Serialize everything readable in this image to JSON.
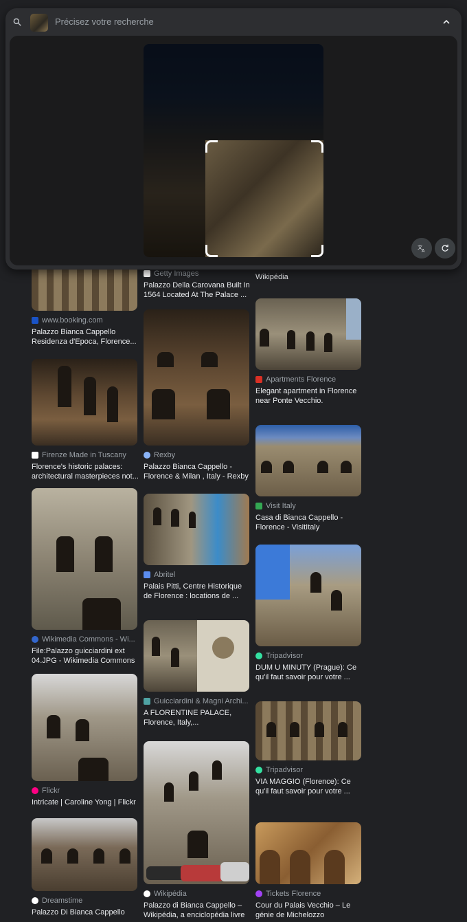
{
  "search": {
    "placeholder": "Précisez votre recherche",
    "icons": {
      "search": "search-icon",
      "collapse": "chevron-up-icon",
      "translate": "translate-icon",
      "rotate": "rotate-icon"
    }
  },
  "results": {
    "col1": [
      {
        "source": "www.booking.com",
        "source_color": "#1a53c6",
        "title": "Palazzo Bianca Cappello Residenza d'Epoca, Florence..."
      },
      {
        "source": "Firenze Made in Tuscany",
        "source_color": "#ffffff",
        "title": "Florence's historic palaces: architectural masterpieces not..."
      },
      {
        "source": "Wikimedia Commons - Wi...",
        "source_color": "#3366cc",
        "title": "File:Palazzo guicciardini ext 04.JPG - Wikimedia Commons"
      },
      {
        "source": "Flickr",
        "source_color": "#ff0084",
        "title": "Intricate | Caroline Yong | Flickr"
      },
      {
        "source": "Dreamstime",
        "source_color": "#ffffff",
        "title": "Palazzo Di Bianca Cappello"
      }
    ],
    "col2": [
      {
        "source": "Getty Images",
        "source_color": "#ffffff",
        "title": "Palazzo Della Carovana Built In 1564 Located At The Palace ..."
      },
      {
        "source": "Rexby",
        "source_color": "#8ab4f8",
        "title": "Palazzo Bianca Cappello - Florence & Milan , Italy - Rexby"
      },
      {
        "source": "Abritel",
        "source_color": "#5b8def",
        "title": "Palais Pitti, Centre Historique de Florence : locations de ..."
      },
      {
        "source": "Guicciardini & Magni Archi...",
        "source_color": "#4fa3a3",
        "title": "A FLORENTINE PALACE, Florence, Italy,..."
      },
      {
        "source": "Wikipédia",
        "source_color": "#ffffff",
        "title": "Palazzo di Bianca Cappello – Wikipédia, a enciclopédia livre"
      }
    ],
    "col3": [
      {
        "source": "",
        "source_color": "#ffffff",
        "title": "Wikipédia"
      },
      {
        "source": "Apartments Florence",
        "source_color": "#d93025",
        "title": "Elegant apartment in Florence near Ponte Vecchio."
      },
      {
        "source": "Visit Italy",
        "source_color": "#34a853",
        "title": "Casa di Bianca Cappello - Florence - VisitItaly"
      },
      {
        "source": "Tripadvisor",
        "source_color": "#34e0a1",
        "title": "DUM U MINUTY (Prague): Ce qu'il faut savoir pour votre ..."
      },
      {
        "source": "Tripadvisor",
        "source_color": "#34e0a1",
        "title": "VIA MAGGIO (Florence): Ce qu'il faut savoir pour votre ..."
      },
      {
        "source": "Tickets Florence",
        "source_color": "#a142f4",
        "title": "Cour du Palais Vecchio – Le génie de Michelozzo"
      }
    ]
  }
}
